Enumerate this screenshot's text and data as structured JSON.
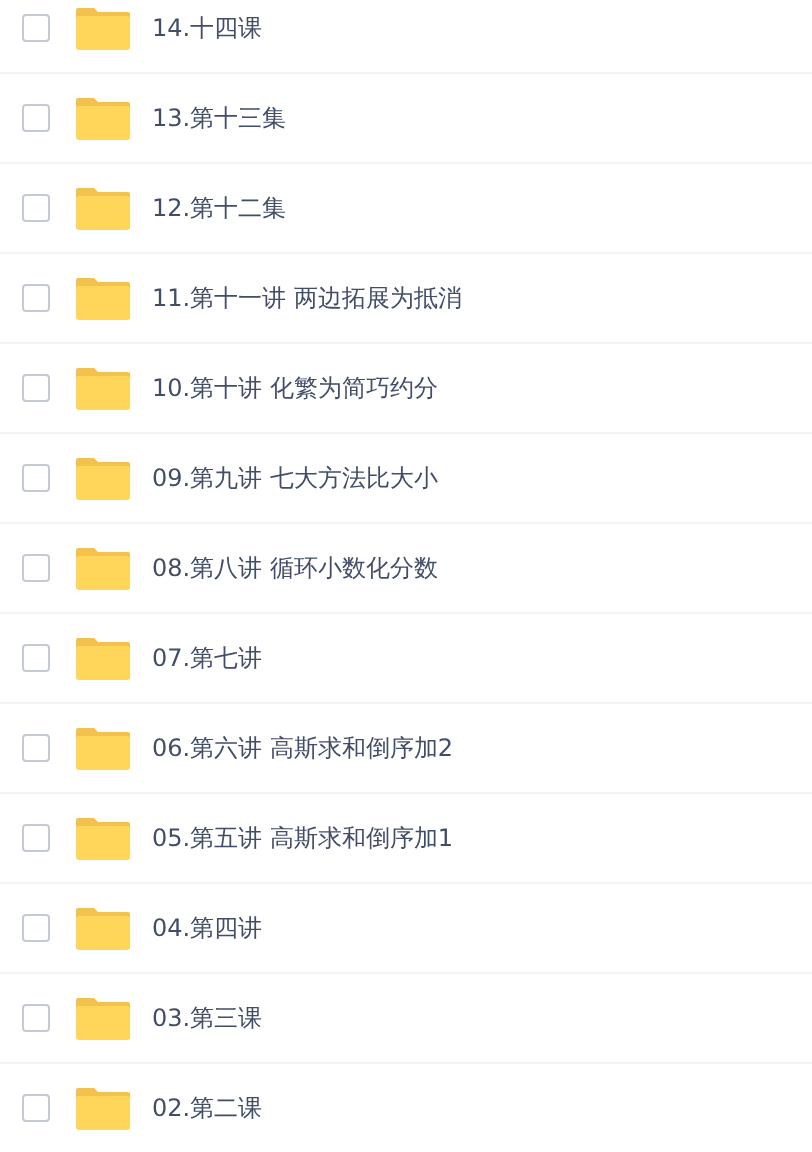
{
  "files": [
    {
      "name": "14.十四课",
      "checked": false
    },
    {
      "name": "13.第十三集",
      "checked": false
    },
    {
      "name": "12.第十二集",
      "checked": false
    },
    {
      "name": "11.第十一讲 两边拓展为抵消",
      "checked": false
    },
    {
      "name": "10.第十讲 化繁为简巧约分",
      "checked": false
    },
    {
      "name": "09.第九讲 七大方法比大小",
      "checked": false
    },
    {
      "name": "08.第八讲 循环小数化分数",
      "checked": false
    },
    {
      "name": "07.第七讲",
      "checked": false
    },
    {
      "name": "06.第六讲 高斯求和倒序加2",
      "checked": false
    },
    {
      "name": "05.第五讲 高斯求和倒序加1",
      "checked": false
    },
    {
      "name": "04.第四讲",
      "checked": false
    },
    {
      "name": "03.第三课",
      "checked": false
    },
    {
      "name": "02.第二课",
      "checked": false
    }
  ]
}
